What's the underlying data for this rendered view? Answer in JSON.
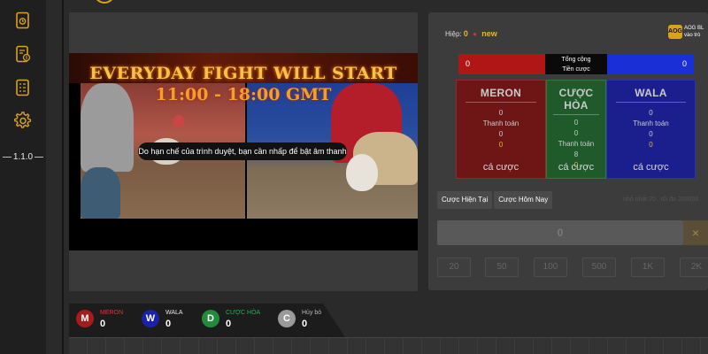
{
  "sidebar": {
    "items": [
      {
        "icon": "history-document-icon"
      },
      {
        "icon": "money-document-icon"
      },
      {
        "icon": "report-list-icon"
      },
      {
        "icon": "gear-icon"
      }
    ],
    "version": "1.1.0"
  },
  "video": {
    "banner_title": "EVERYDAY FIGHT WILL START",
    "banner_time": "11:00 - 18:00 GMT",
    "sound_notice": "Do hạn chế của trình duyệt, bạn cần nhấp để bật âm thanh"
  },
  "status_bar": [
    {
      "letter": "M",
      "label": "MERON",
      "value": "0",
      "color": "#a51c1c",
      "label_color": "#d63a3a"
    },
    {
      "letter": "W",
      "label": "WALA",
      "value": "0",
      "color": "#1a23a8",
      "label_color": "#e6e6e6"
    },
    {
      "letter": "D",
      "label": "CƯỢC HÒA",
      "value": "0",
      "color": "#238a3c",
      "label_color": "#2fb04a"
    },
    {
      "letter": "C",
      "label": "Hủy bỏ",
      "value": "0",
      "color": "#9a9a9a",
      "label_color": "#bbbbbb"
    }
  ],
  "panel": {
    "round_label": "Hiệp:",
    "round_number": "0",
    "round_status": "new",
    "brand_logo": "AOG",
    "brand_text_1": "AOG BL",
    "brand_text_2": "vào trò",
    "totals": {
      "left": "0",
      "center_line1": "Tổng cộng",
      "center_line2": "Tiền cược",
      "right": "0"
    },
    "bets": {
      "meron": {
        "title": "MERON",
        "total": "0",
        "payout_label": "Thanh toán",
        "payout": "0",
        "mine": "0",
        "cta": "cá cược"
      },
      "draw": {
        "title": "CƯỢC HÒA",
        "total1": "0",
        "total2": "0",
        "payout_label": "Thanh toán",
        "payout": "8",
        "mine": "0",
        "cta": "cá cược"
      },
      "wala": {
        "title": "WALA",
        "total": "0",
        "payout_label": "Thanh toán",
        "payout": "0",
        "mine": "0",
        "cta": "cá cược"
      }
    },
    "tabs": [
      "Cược Hiện Tại",
      "Cược Hôm Nay"
    ],
    "hint": "nhỏ nhất 20 , tối đa 200000",
    "amount": "0",
    "clear_symbol": "×",
    "chips": [
      "20",
      "50",
      "100",
      "500",
      "1K",
      "2K"
    ]
  },
  "colors": {
    "accent": "#f0b429",
    "meron": "#b01616",
    "wala": "#1b2fd6",
    "draw": "#1f5a2b"
  }
}
